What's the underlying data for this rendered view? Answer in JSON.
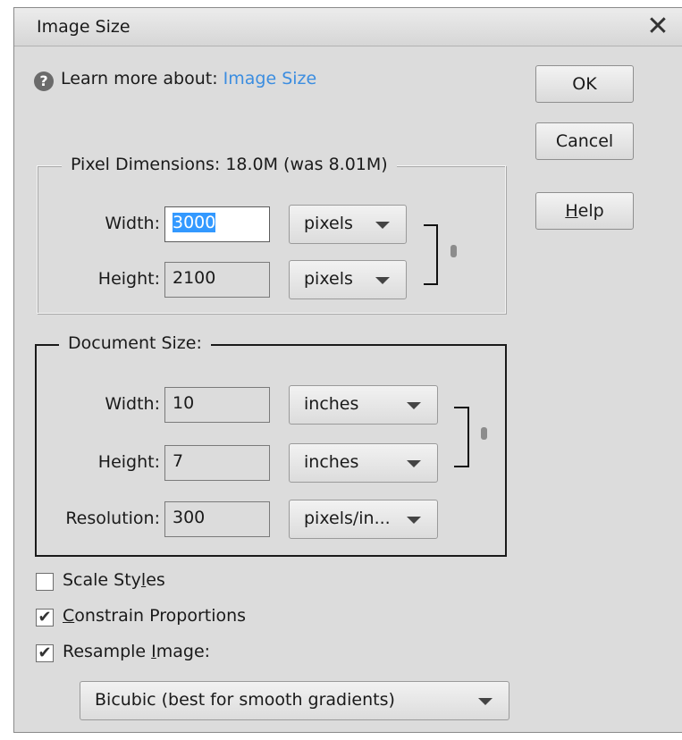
{
  "window": {
    "title": "Image Size",
    "close_glyph": "✕"
  },
  "learn": {
    "prefix": "Learn more about: ",
    "link": "Image Size",
    "icon": "help-circle-icon"
  },
  "buttons": {
    "ok": "OK",
    "cancel": "Cancel",
    "help_ul": "H",
    "help_rest": "elp"
  },
  "pixel_dimensions": {
    "legend": "Pixel Dimensions:  18.0M (was 8.01M)",
    "width_label": "Width:",
    "width_value": "3000",
    "width_unit": "pixels",
    "height_label": "Height:",
    "height_value": "2100",
    "height_unit": "pixels"
  },
  "document_size": {
    "legend": "Document Size:",
    "width_label": "Width:",
    "width_value": "10",
    "width_unit": "inches",
    "height_label": "Height:",
    "height_value": "7",
    "height_unit": "inches",
    "resolution_label": "Resolution:",
    "resolution_value": "300",
    "resolution_unit": "pixels/in..."
  },
  "options": {
    "scale_styles": {
      "pre": "Scale Sty",
      "ul": "l",
      "post": "es",
      "checked": false
    },
    "constrain": {
      "pre": "",
      "ul": "C",
      "post": "onstrain Proportions",
      "checked": true
    },
    "resample": {
      "pre": "Resample ",
      "ul": "I",
      "post": "mage:",
      "checked": true
    }
  },
  "resample_method": "Bicubic (best for smooth gradients)",
  "check_glyph": "✔"
}
